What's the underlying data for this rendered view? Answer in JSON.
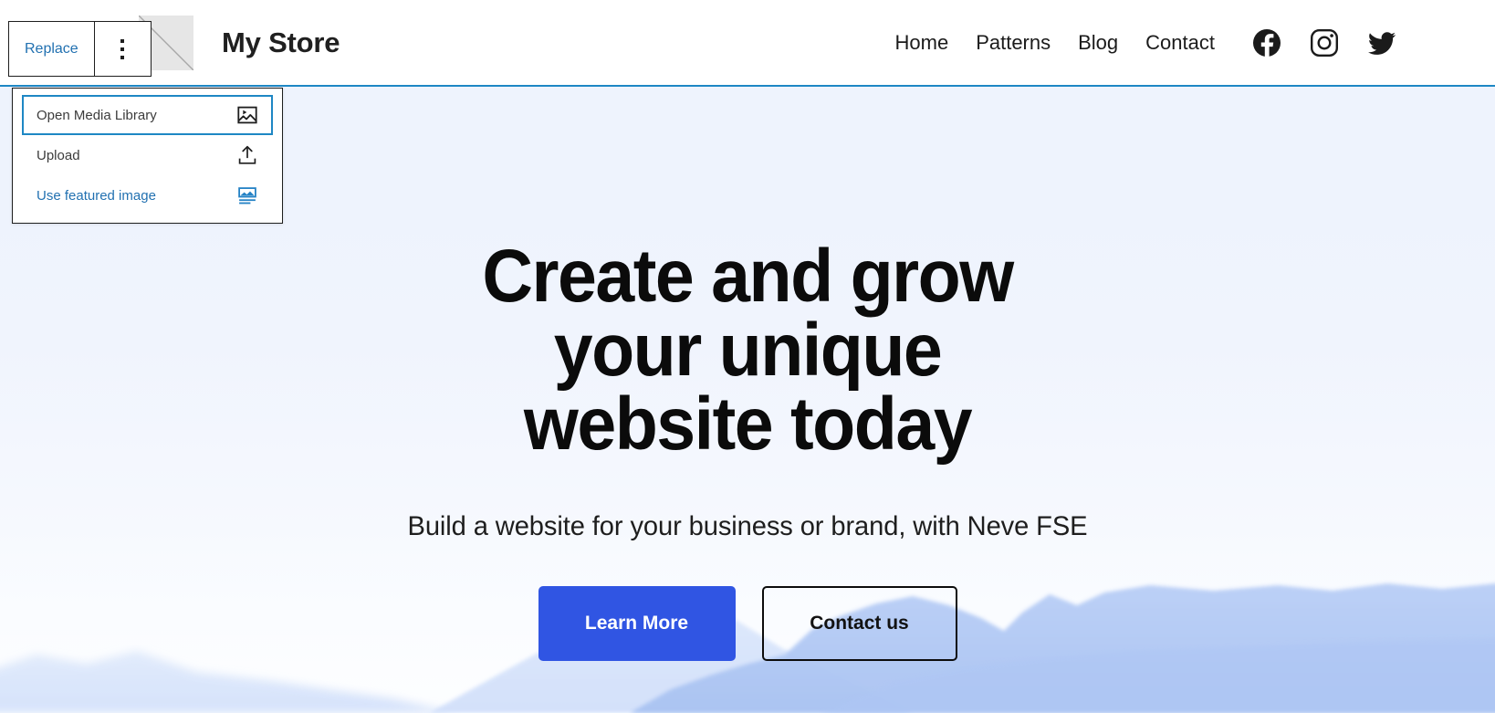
{
  "editor": {
    "block_toolbar": {
      "replace_label": "Replace",
      "more_options_label": "Options",
      "more_options_icon": "dots-vertical-icon"
    },
    "replace_dropdown": {
      "items": [
        {
          "label": "Open Media Library",
          "icon": "image-icon",
          "focused": true,
          "accent": false
        },
        {
          "label": "Upload",
          "icon": "upload-icon",
          "focused": false,
          "accent": false
        },
        {
          "label": "Use featured image",
          "icon": "featured-image-icon",
          "focused": false,
          "accent": true
        }
      ]
    },
    "selection_accent_color": "#1e87c4"
  },
  "site_header": {
    "logo_alt": "site-logo-placeholder",
    "title": "My Store",
    "nav": [
      {
        "label": "Home"
      },
      {
        "label": "Patterns"
      },
      {
        "label": "Blog"
      },
      {
        "label": "Contact"
      }
    ],
    "social": [
      {
        "name": "facebook-icon"
      },
      {
        "name": "instagram-icon"
      },
      {
        "name": "twitter-icon"
      }
    ]
  },
  "hero": {
    "title": "Create and grow your unique website today",
    "subtitle": "Build a website for your business or brand, with Neve FSE",
    "primary_button": "Learn More",
    "secondary_button": "Contact us",
    "primary_button_color": "#3055e3",
    "background_top_color": "#eef3fd",
    "background_bottom_color": "#fdfeff",
    "mountain_color": "#b3cbf5"
  }
}
